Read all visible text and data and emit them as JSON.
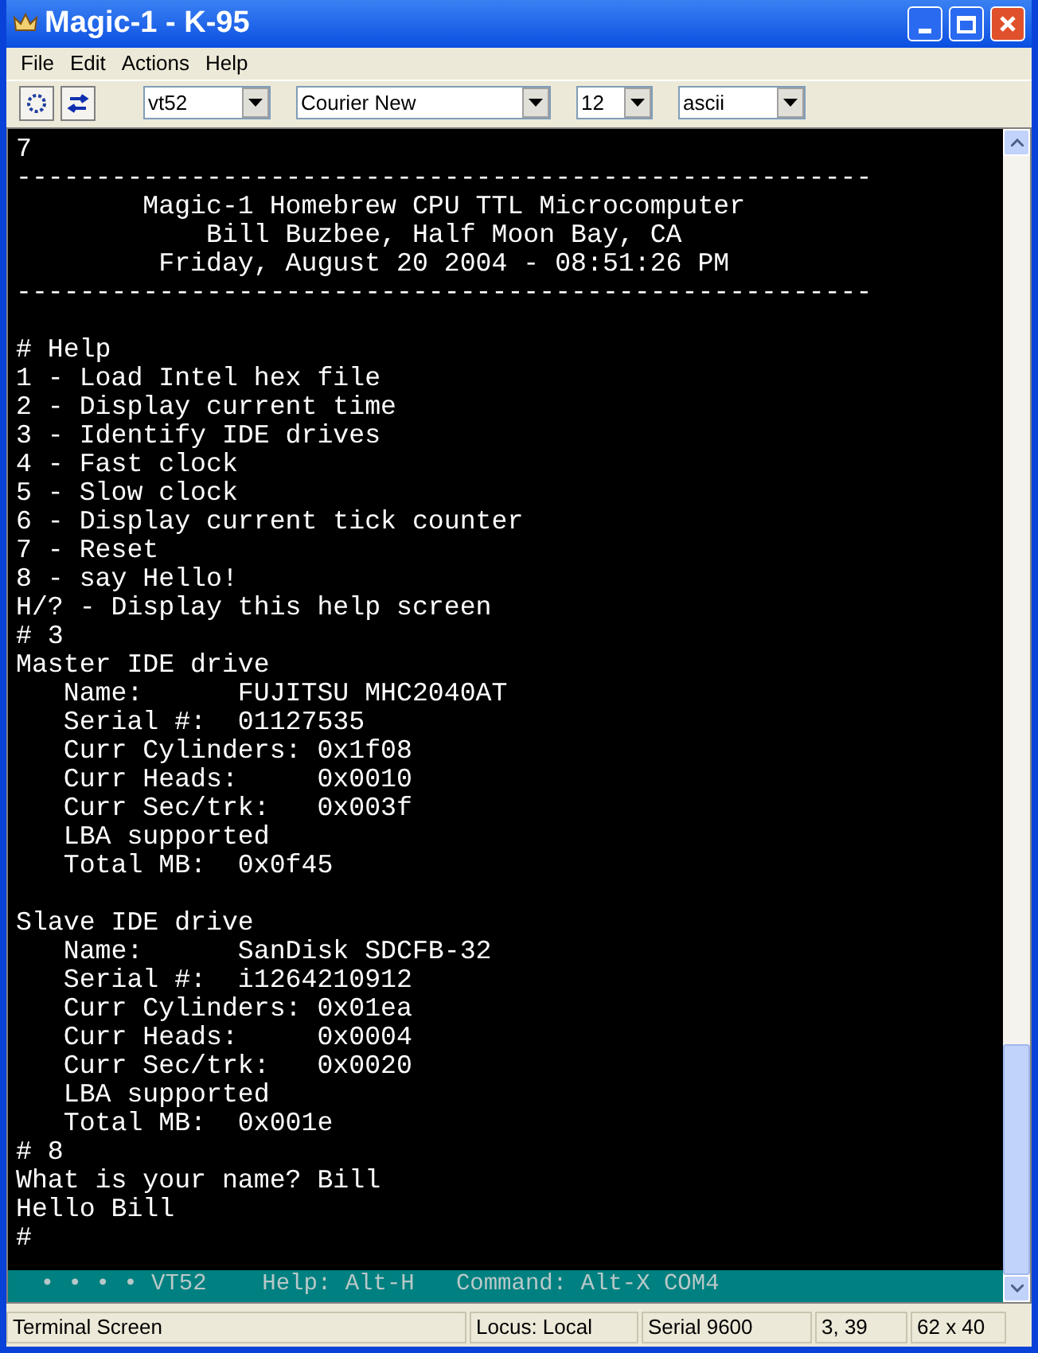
{
  "window": {
    "title": "Magic-1 - K-95"
  },
  "menu": [
    "File",
    "Edit",
    "Actions",
    "Help"
  ],
  "toolbar": {
    "dropdowns": [
      {
        "value": "vt52",
        "kind": "small"
      },
      {
        "value": "Courier New",
        "kind": "wide"
      },
      {
        "value": "12",
        "kind": "tiny"
      },
      {
        "value": "ascii",
        "kind": "small"
      }
    ]
  },
  "terminal": {
    "blocks": [
      {
        "lines": [
          "7",
          "------------------------------------------------------",
          "        Magic-1 Homebrew CPU TTL Microcomputer",
          "            Bill Buzbee, Half Moon Bay, CA",
          "         Friday, August 20 2004 - 08:51:26 PM",
          "------------------------------------------------------"
        ]
      },
      {
        "lines": [
          "# Help",
          "1 - Load Intel hex file",
          "2 - Display current time",
          "3 - Identify IDE drives",
          "4 - Fast clock",
          "5 - Slow clock",
          "6 - Display current tick counter",
          "7 - Reset",
          "8 - say Hello!",
          "H/? - Display this help screen",
          "# 3",
          "Master IDE drive",
          "   Name:      FUJITSU MHC2040AT",
          "   Serial #:  01127535",
          "   Curr Cylinders: 0x1f08",
          "   Curr Heads:     0x0010",
          "   Curr Sec/trk:   0x003f",
          "   LBA supported",
          "   Total MB:  0x0f45"
        ]
      },
      {
        "lines": [
          "Slave IDE drive",
          "   Name:      SanDisk SDCFB-32",
          "   Serial #:  i1264210912",
          "   Curr Cylinders: 0x01ea",
          "   Curr Heads:     0x0004",
          "   Curr Sec/trk:   0x0020",
          "   LBA supported",
          "   Total MB:  0x001e",
          "# 8",
          "What is your name? Bill",
          "Hello Bill",
          "#"
        ]
      }
    ],
    "status": "  • • • • VT52    Help: Alt-H   Command: Alt-X COM4"
  },
  "status_bar": [
    "Terminal Screen",
    "Locus: Local",
    "Serial 9600",
    "3, 39",
    "62 x 40"
  ]
}
